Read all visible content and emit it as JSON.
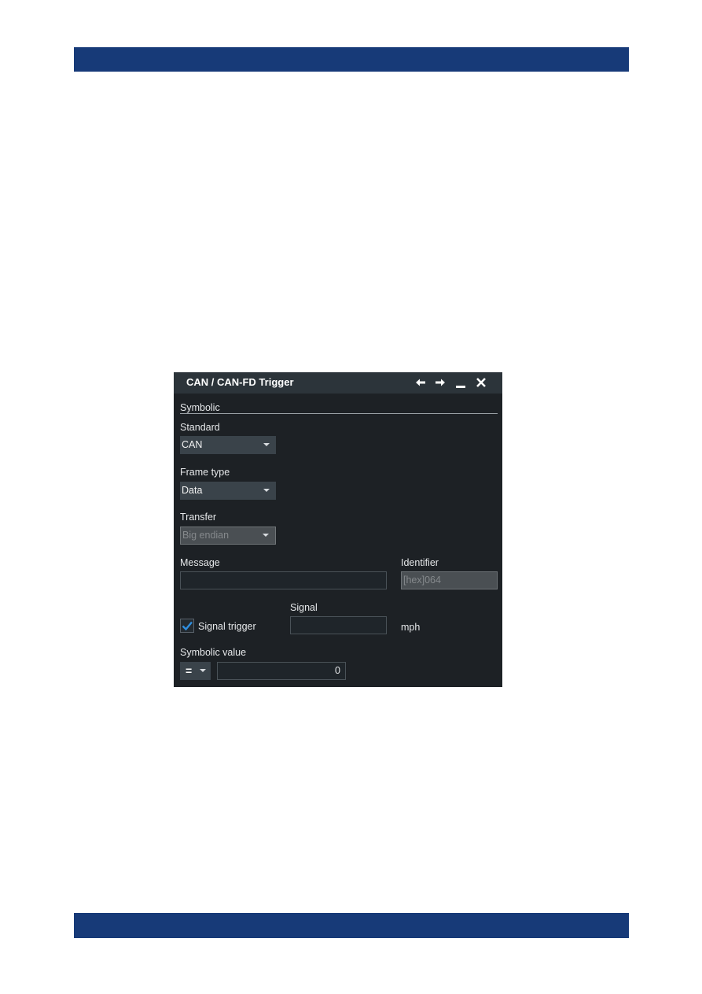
{
  "page": {
    "header_band_color": "#173a78",
    "footer_band_color": "#173a78"
  },
  "dialog": {
    "title": "CAN / CAN-FD Trigger",
    "titlebar_icons": [
      "arrow-left-icon",
      "arrow-right-icon",
      "minimize-icon",
      "close-icon"
    ],
    "section": "Symbolic",
    "standard": {
      "label": "Standard",
      "value": "CAN"
    },
    "frame_type": {
      "label": "Frame type",
      "value": "Data"
    },
    "transfer": {
      "label": "Transfer",
      "value": "Big endian",
      "disabled": true
    },
    "message": {
      "label": "Message",
      "value": ""
    },
    "identifier": {
      "label": "Identifier",
      "value": "[hex]064",
      "disabled": true
    },
    "signal_trigger": {
      "label": "Signal trigger",
      "checked": true,
      "accent": "#2f8fe0"
    },
    "signal": {
      "label": "Signal",
      "value": "",
      "unit": "mph"
    },
    "symbolic_value": {
      "label": "Symbolic value",
      "operator": "=",
      "value": "0"
    }
  }
}
